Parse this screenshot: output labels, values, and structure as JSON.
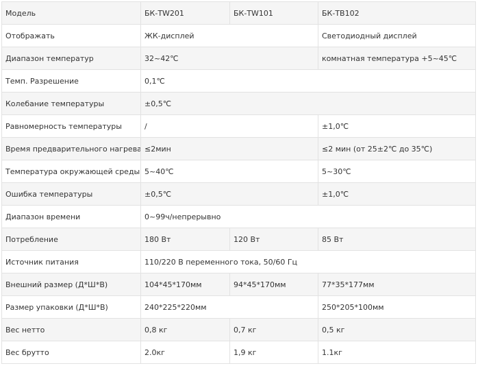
{
  "rows": [
    {
      "label": "Модель",
      "cells": [
        {
          "text": "БК-TW201",
          "span": 1
        },
        {
          "text": "БК-TW101",
          "span": 1
        },
        {
          "text": "БК-TB102",
          "span": 1
        }
      ]
    },
    {
      "label": "Отображать",
      "cells": [
        {
          "text": "ЖК-дисплей",
          "span": 2
        },
        {
          "text": "Светодиодный дисплей",
          "span": 1
        }
      ]
    },
    {
      "label": "Диапазон температур",
      "cells": [
        {
          "text": "32~42℃",
          "span": 2
        },
        {
          "text": "комнатная температура +5~45℃",
          "span": 1
        }
      ]
    },
    {
      "label": "Темп. Разрешение",
      "cells": [
        {
          "text": "0,1℃",
          "span": 3
        }
      ]
    },
    {
      "label": "Колебание температуры",
      "cells": [
        {
          "text": "±0,5℃",
          "span": 3
        }
      ]
    },
    {
      "label": "Равномерность температуры",
      "cells": [
        {
          "text": "/",
          "span": 2
        },
        {
          "text": "±1,0℃",
          "span": 1
        }
      ]
    },
    {
      "label": "Время предварительного нагрева",
      "cells": [
        {
          "text": "≤2мин",
          "span": 2
        },
        {
          "text": "≤2 мин (от 25±2℃ до 35℃)",
          "span": 1
        }
      ]
    },
    {
      "label": "Температура окружающей среды",
      "cells": [
        {
          "text": "5~40℃",
          "span": 2
        },
        {
          "text": "5~30℃",
          "span": 1
        }
      ]
    },
    {
      "label": "Ошибка температуры",
      "cells": [
        {
          "text": "±0,5℃",
          "span": 2
        },
        {
          "text": "±1,0℃",
          "span": 1
        }
      ]
    },
    {
      "label": "Диапазон времени",
      "cells": [
        {
          "text": "0~99ч/непрерывно",
          "span": 3
        }
      ]
    },
    {
      "label": "Потребление",
      "cells": [
        {
          "text": "180 Вт",
          "span": 1
        },
        {
          "text": "120 Вт",
          "span": 1
        },
        {
          "text": "85 Вт",
          "span": 1
        }
      ]
    },
    {
      "label": "Источник питания",
      "cells": [
        {
          "text": "110/220 В переменного тока, 50/60 Гц",
          "span": 3
        }
      ]
    },
    {
      "label": "Внешний размер (Д*Ш*В)",
      "cells": [
        {
          "text": "104*45*170мм",
          "span": 1
        },
        {
          "text": "94*45*170мм",
          "span": 1
        },
        {
          "text": "77*35*177мм",
          "span": 1
        }
      ]
    },
    {
      "label": "Размер упаковки (Д*Ш*В)",
      "cells": [
        {
          "text": "240*225*220мм",
          "span": 2
        },
        {
          "text": "250*205*100мм",
          "span": 1
        }
      ]
    },
    {
      "label": "Вес нетто",
      "cells": [
        {
          "text": "0,8 кг",
          "span": 1
        },
        {
          "text": "0,7 кг",
          "span": 1
        },
        {
          "text": "0,5 кг",
          "span": 1
        }
      ]
    },
    {
      "label": "Вес брутто",
      "cells": [
        {
          "text": "2.0кг",
          "span": 1
        },
        {
          "text": "1,9 кг",
          "span": 1
        },
        {
          "text": "1.1кг",
          "span": 1
        }
      ]
    }
  ]
}
